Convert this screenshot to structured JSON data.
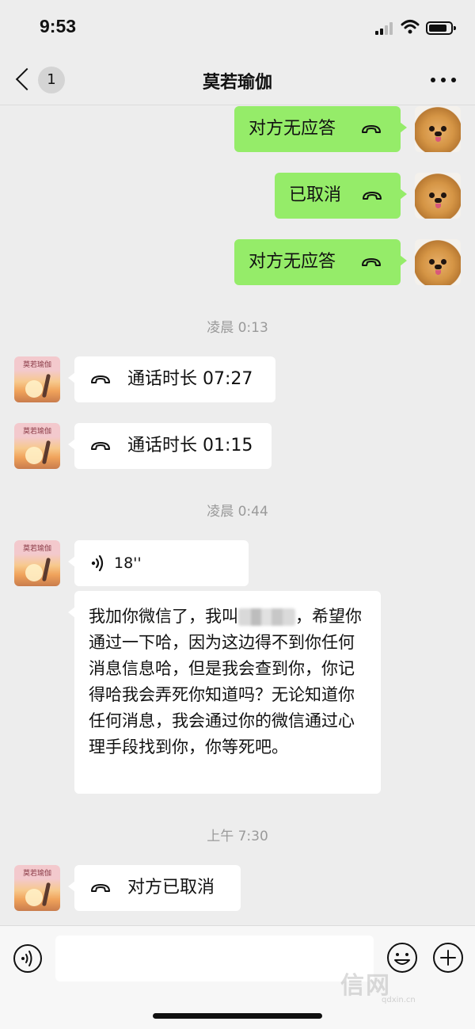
{
  "status_bar": {
    "time": "9:53"
  },
  "header": {
    "unread_count": "1",
    "title": "莫若瑜伽"
  },
  "avatar_label": "莫若瑜伽",
  "messages": {
    "out_1": "对方无应答",
    "out_2": "已取消",
    "out_3": "对方无应答",
    "time_1": "凌晨 0:13",
    "in_call_1": "通话时长 07:27",
    "in_call_2": "通话时长 01:15",
    "time_2": "凌晨 0:44",
    "voice_duration": "18''",
    "text_part_1": "我加你微信了，我叫",
    "text_part_2": "，希望你通过一下哈，因为这边得不到你任何消息信息哈，但是我会查到你，你记得哈我会弄死你知道吗？无论知道你任何消息，我会通过你的微信通过心理手段找到你，你等死吧。",
    "time_3": "上午 7:30",
    "in_call_3": "对方已取消"
  },
  "input_bar": {
    "value": "",
    "placeholder": ""
  },
  "watermark": {
    "main": "信网",
    "sub": "qdxin.cn"
  },
  "colors": {
    "background": "#ededed",
    "outgoing_bubble": "#95ec69",
    "incoming_bubble": "#ffffff",
    "timestamp_text": "#9a9a9a"
  },
  "icons": [
    "back-chevron-icon",
    "more-dots-icon",
    "phone-hangup-icon",
    "voice-wave-icon",
    "voice-toggle-icon",
    "emoji-icon",
    "plus-icon",
    "wifi-icon",
    "battery-icon",
    "signal-icon"
  ]
}
